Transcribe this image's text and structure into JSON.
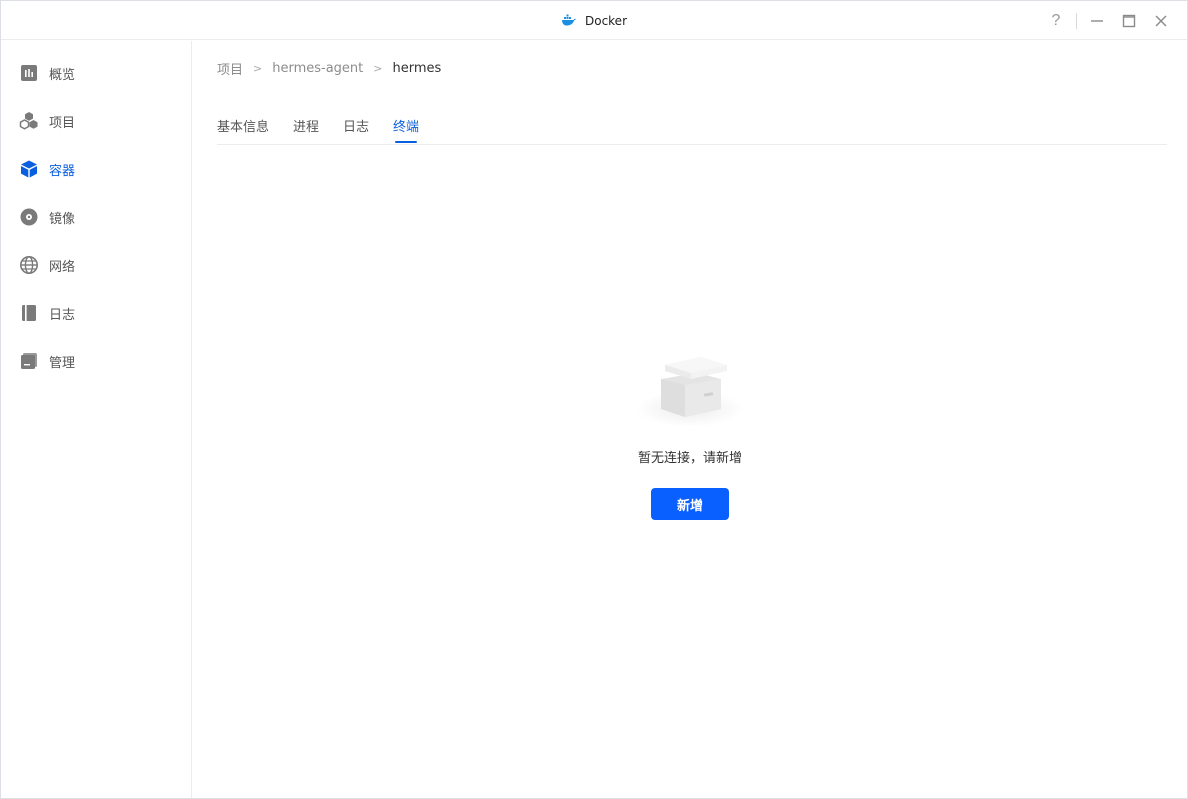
{
  "window": {
    "title": "Docker"
  },
  "sidebar": {
    "items": [
      {
        "label": "概览",
        "icon": "overview-icon",
        "active": false
      },
      {
        "label": "项目",
        "icon": "project-icon",
        "active": false
      },
      {
        "label": "容器",
        "icon": "container-icon",
        "active": true
      },
      {
        "label": "镜像",
        "icon": "image-icon",
        "active": false
      },
      {
        "label": "网络",
        "icon": "network-icon",
        "active": false
      },
      {
        "label": "日志",
        "icon": "log-icon",
        "active": false
      },
      {
        "label": "管理",
        "icon": "manage-icon",
        "active": false
      }
    ]
  },
  "breadcrumb": {
    "items": [
      "项目",
      "hermes-agent",
      "hermes"
    ],
    "separator": ">"
  },
  "tabs": [
    {
      "label": "基本信息",
      "active": false
    },
    {
      "label": "进程",
      "active": false
    },
    {
      "label": "日志",
      "active": false
    },
    {
      "label": "终端",
      "active": true
    }
  ],
  "empty_state": {
    "message": "暂无连接，请新增",
    "button_label": "新增"
  },
  "colors": {
    "accent": "#0a5fe0",
    "button": "#0a5fff"
  }
}
